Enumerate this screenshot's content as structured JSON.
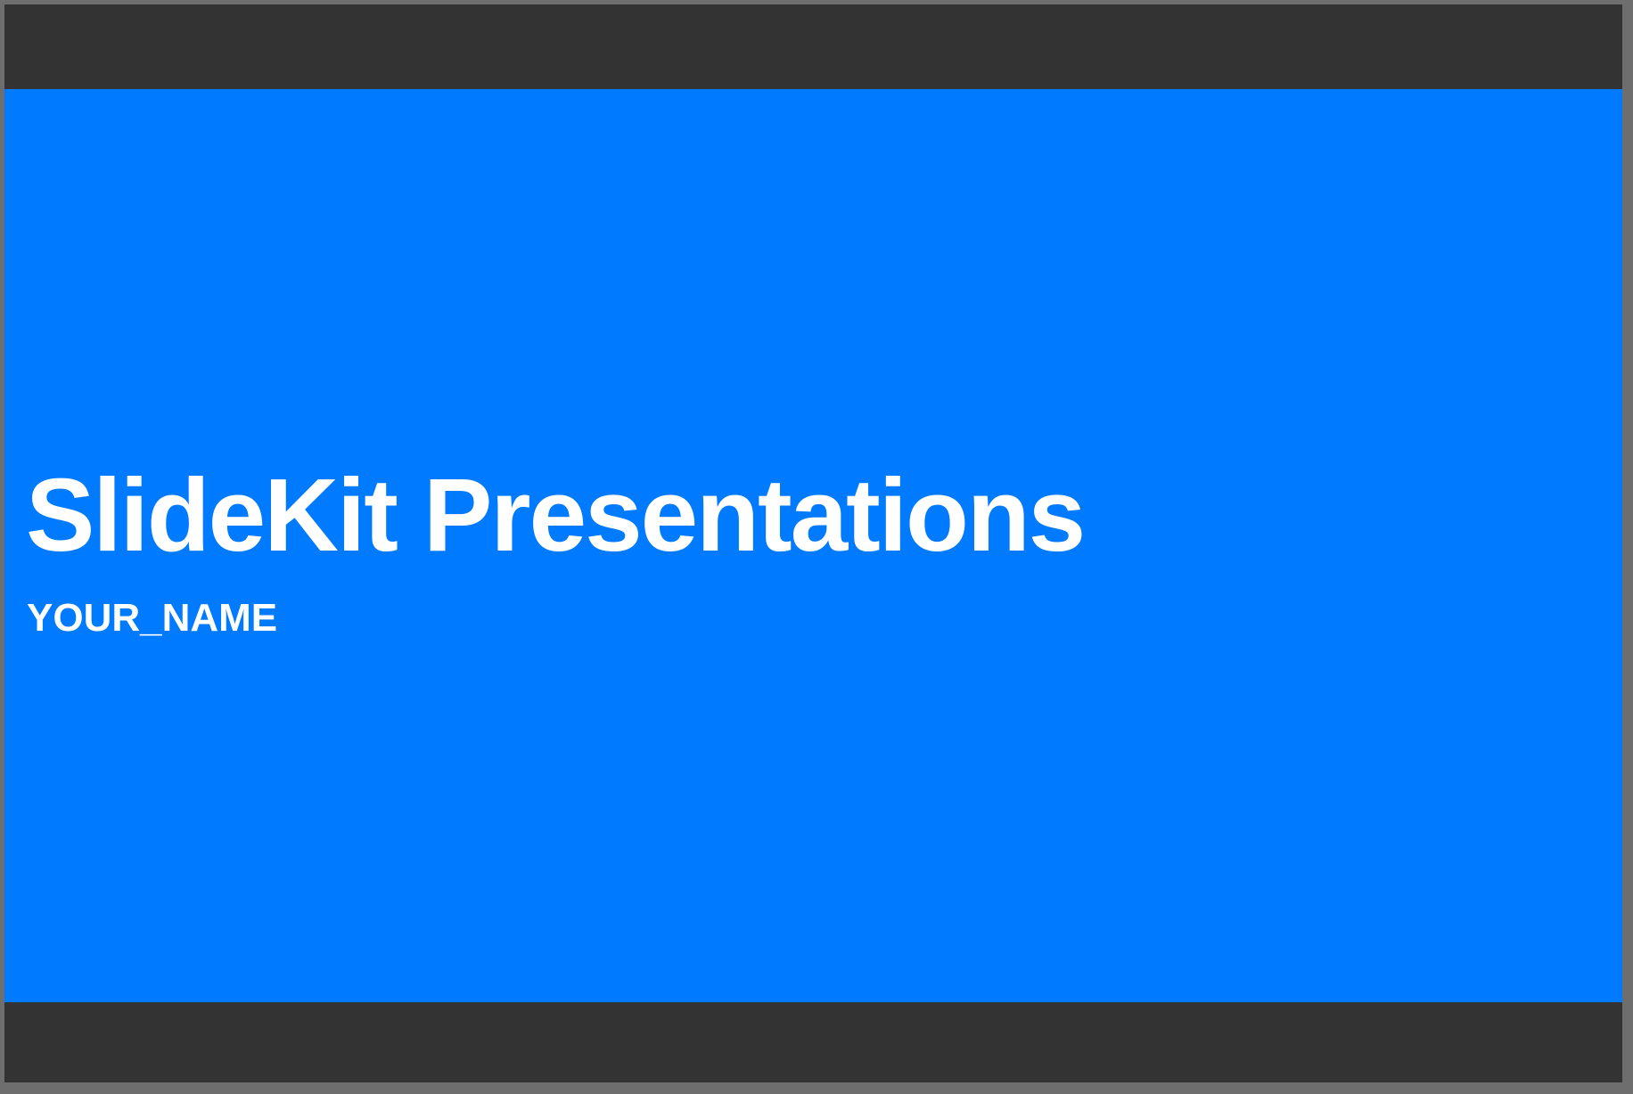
{
  "slide": {
    "title": "SlideKit Presentations",
    "subtitle": "YOUR_NAME"
  },
  "colors": {
    "slide_background": "#007aff",
    "letterbox": "#333333",
    "frame": "#6e6e6e",
    "text": "#ffffff"
  }
}
